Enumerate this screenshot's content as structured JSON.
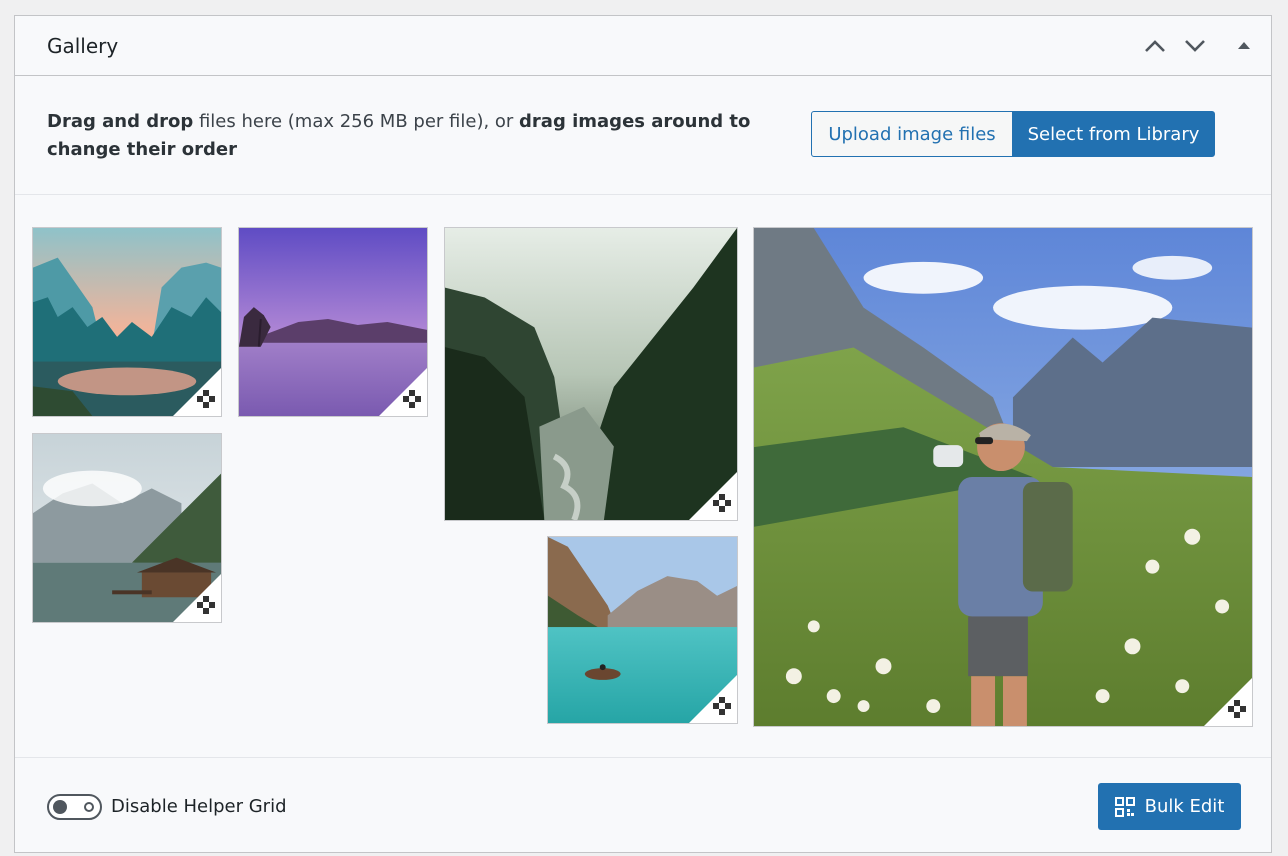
{
  "panel": {
    "title": "Gallery",
    "move_up_label": "Move up",
    "move_down_label": "Move down",
    "toggle_label": "Toggle panel"
  },
  "upload": {
    "instructions": {
      "part1_bold": "Drag and drop",
      "part2": " files here (max 256 MB per file), or ",
      "part3_bold": "drag images around to change their order"
    },
    "upload_button": "Upload image files",
    "library_button": "Select from Library"
  },
  "gallery": {
    "images": [
      {
        "scene": "lake-forest-sunset",
        "size": "small"
      },
      {
        "scene": "purple-lake",
        "size": "small"
      },
      {
        "scene": "misty-valley-river",
        "size": "medium"
      },
      {
        "scene": "hiker-mountain-meadow",
        "size": "large"
      },
      {
        "scene": "mountain-lake-boathouse",
        "size": "small"
      },
      {
        "scene": "turquoise-lake-boat",
        "size": "small"
      }
    ]
  },
  "footer": {
    "helper_grid_label": "Disable Helper Grid",
    "bulk_edit_label": "Bulk Edit"
  },
  "colors": {
    "accent": "#2271b1",
    "border": "#c3c4c7"
  },
  "icons": [
    "chevron-up-icon",
    "chevron-down-icon",
    "triangle-up-icon",
    "resize-handle-icon",
    "bulk-edit-icon",
    "toggle-switch"
  ]
}
